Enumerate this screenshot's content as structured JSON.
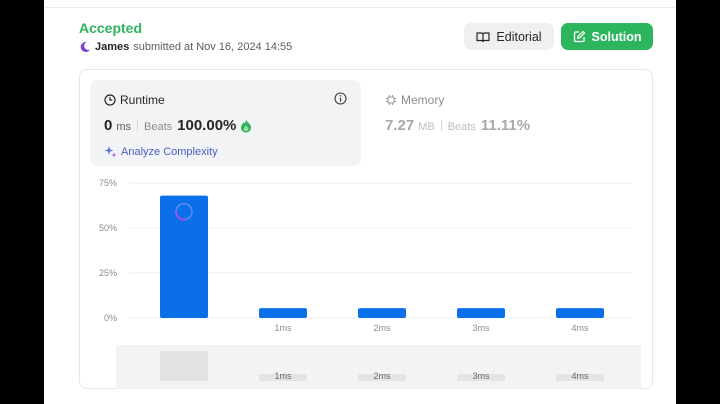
{
  "submission": {
    "status": "Accepted",
    "user": "James",
    "submitted_text": "submitted at Nov 16, 2024 14:55"
  },
  "buttons": {
    "editorial": "Editorial",
    "solution": "Solution"
  },
  "runtime": {
    "title": "Runtime",
    "value": "0",
    "unit": "ms",
    "beats_label": "Beats",
    "beats_value": "100.00%",
    "analyze": "Analyze Complexity"
  },
  "memory": {
    "title": "Memory",
    "value": "7.27",
    "unit": "MB",
    "beats_label": "Beats",
    "beats_value": "11.11%"
  },
  "colors": {
    "accepted": "#2cb55e",
    "solution_button": "#2db55d",
    "bar": "#0a6fe8",
    "analyze": "#4a5fc4"
  },
  "icons": {
    "avatar": "crescent-avatar-icon",
    "editorial": "book-icon",
    "solution": "edit-square-icon",
    "runtime": "clock-icon",
    "memory": "chip-icon",
    "info": "info-icon",
    "analyze": "sparkle-icon",
    "beats": "flame-icon"
  },
  "chart_data": {
    "type": "bar",
    "categories": [
      "",
      "1ms",
      "2ms",
      "3ms",
      "4ms"
    ],
    "values": [
      68,
      5.5,
      5.5,
      5.5,
      5.5
    ],
    "ylim": [
      0,
      75
    ],
    "yticks": [
      "0%",
      "25%",
      "50%",
      "75%"
    ],
    "ytick_values": [
      0,
      25,
      50,
      75
    ],
    "grid": true,
    "highlight_index": 0,
    "minimap_labels": [
      "",
      "1ms",
      "2ms",
      "3ms",
      "4ms"
    ]
  }
}
